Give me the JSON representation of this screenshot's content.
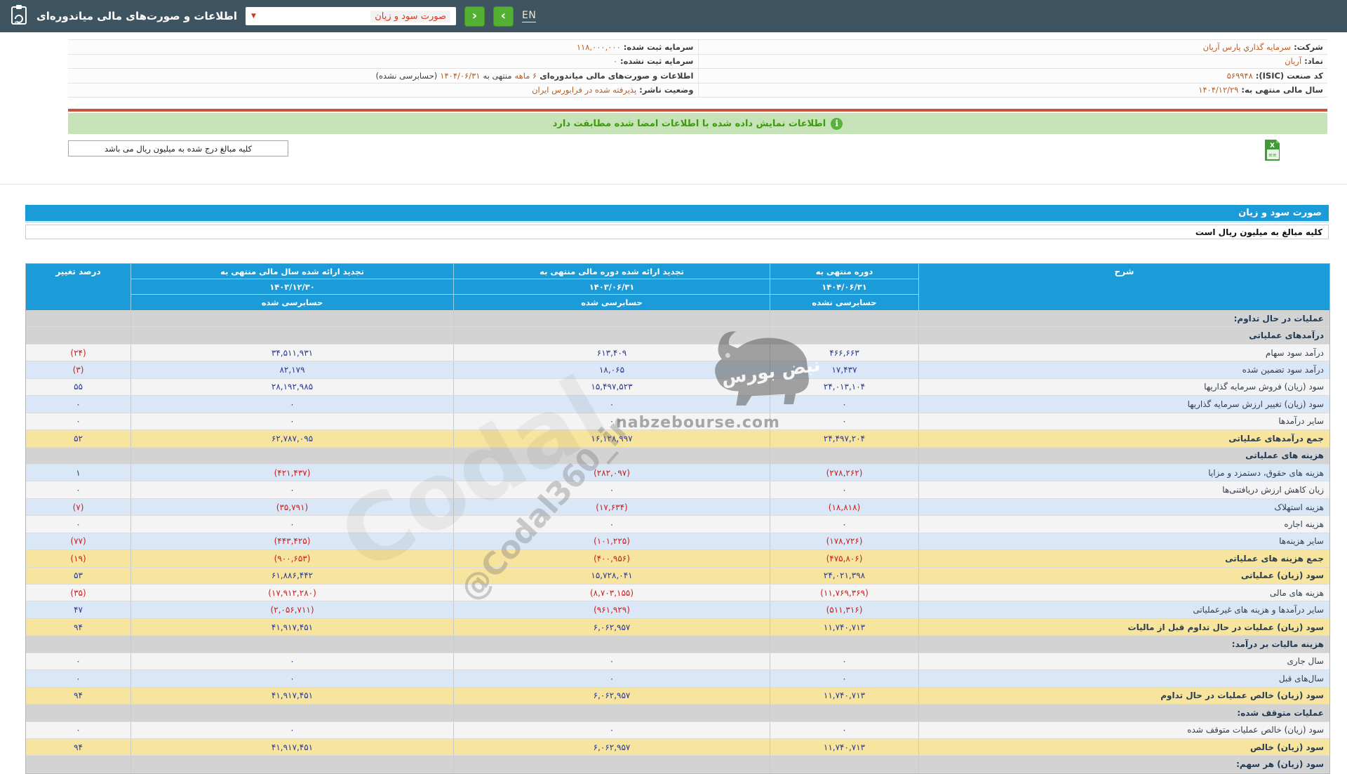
{
  "topbar": {
    "en_label": "EN",
    "title": "اطلاعات و صورت‌های مالی میاندوره‌ای",
    "dropdown_value": "صورت سود و زیان",
    "dropdown_caret": "▼",
    "next_label": "›",
    "prev_label": "‹"
  },
  "company": {
    "rows": [
      {
        "r_label": "شرکت:",
        "r_value": "سرمایه گذاري پارس آریان",
        "l_label": "سرمایه ثبت شده:",
        "l_v1": "۱۱۸,۰۰۰,۰۰۰"
      },
      {
        "r_label": "نماد:",
        "r_value": "آریان",
        "l_label": "سرمایه ثبت نشده:",
        "l_v1": "۰"
      },
      {
        "r_label": "کد صنعت (ISIC):",
        "r_value": "۵۶۹۹۴۸",
        "l_label": "اطلاعات و صورت‌های مالی میاندوره‌ای",
        "l_v1": "۶ ماهه",
        "l_mid": "منتهی به",
        "l_v2": "۱۴۰۴/۰۶/۳۱",
        "l_suffix": "(حسابرسی نشده)"
      },
      {
        "r_label": "سال مالی منتهی به:",
        "r_value": "۱۴۰۴/۱۲/۲۹",
        "l_label": "وضعیت ناشر:",
        "l_v1": "پذیرفته شده در فرابورس ایران"
      }
    ]
  },
  "notice": {
    "text": "اطلاعات نمایش داده شده با اطلاعات امضا شده مطابقت دارد",
    "icon_glyph": "i"
  },
  "amounts_note": "کلیه مبالغ درج شده به میلیون ریال می باشد",
  "statement": {
    "title": "صورت سود و زیان",
    "unit_note": "کلیه مبالغ به میلیون ریال است"
  },
  "table": {
    "desc_header": "شرح",
    "pct_header": "درصد تغییر",
    "col_groups": [
      {
        "top": "دوره منتهی به",
        "date": "۱۴۰۴/۰۶/۳۱",
        "audit": "حسابرسی نشده"
      },
      {
        "top": "تجدید ارائه شده دوره مالی منتهی به",
        "date": "۱۴۰۳/۰۶/۳۱",
        "audit": "حسابرسی شده"
      },
      {
        "top": "تجدید ارائه شده سال مالی منتهی به",
        "date": "۱۴۰۳/۱۲/۳۰",
        "audit": "حسابرسی شده"
      }
    ],
    "rows": [
      {
        "variant": "section",
        "label": "عملیات در حال تداوم:"
      },
      {
        "variant": "section",
        "label": "درآمدهای عملیاتی"
      },
      {
        "variant": "white",
        "label": "درآمد سود سهام",
        "c1": "۴۶۶,۶۶۳",
        "c2": "۶۱۳,۴۰۹",
        "c3": "۳۴,۵۱۱,۹۳۱",
        "pct": "(۲۴)"
      },
      {
        "variant": "blue",
        "label": "درآمد سود تضمین شده",
        "c1": "۱۷,۴۳۷",
        "c2": "۱۸,۰۶۵",
        "c3": "۸۲,۱۷۹",
        "pct": "(۳)"
      },
      {
        "variant": "white",
        "label": "سود (زیان) فروش سرمایه گذاریها",
        "c1": "۲۴,۰۱۳,۱۰۴",
        "c2": "۱۵,۴۹۷,۵۲۳",
        "c3": "۲۸,۱۹۲,۹۸۵",
        "pct": "۵۵"
      },
      {
        "variant": "blue",
        "label": "سود (زیان) تغییر ارزش سرمایه گذاریها",
        "c1": "۰",
        "c2": "۰",
        "c3": "۰",
        "pct": "۰"
      },
      {
        "variant": "white",
        "label": "سایر درآمدها",
        "c1": "۰",
        "c2": "۰",
        "c3": "۰",
        "pct": "۰"
      },
      {
        "variant": "yellow",
        "label": "جمع درآمدهای عملیاتی",
        "c1": "۲۴,۴۹۷,۲۰۴",
        "c2": "۱۶,۱۲۸,۹۹۷",
        "c3": "۶۲,۷۸۷,۰۹۵",
        "pct": "۵۲"
      },
      {
        "variant": "section",
        "label": "هزینه های عملیاتی"
      },
      {
        "variant": "blue",
        "label": "هزینه های حقوق، دستمزد و مزایا",
        "c1": "(۲۷۸,۲۶۲)",
        "c2": "(۲۸۲,۰۹۷)",
        "c3": "(۴۲۱,۴۳۷)",
        "pct": "۱"
      },
      {
        "variant": "white",
        "label": "زیان کاهش ارزش دریافتنی‌ها",
        "c1": "۰",
        "c2": "۰",
        "c3": "۰",
        "pct": "۰"
      },
      {
        "variant": "blue",
        "label": "هزینه استهلاک",
        "c1": "(۱۸,۸۱۸)",
        "c2": "(۱۷,۶۳۴)",
        "c3": "(۳۵,۷۹۱)",
        "pct": "(۷)"
      },
      {
        "variant": "white",
        "label": "هزینه اجاره",
        "c1": "۰",
        "c2": "۰",
        "c3": "۰",
        "pct": "۰"
      },
      {
        "variant": "blue",
        "label": "سایر هزینه‌ها",
        "c1": "(۱۷۸,۷۲۶)",
        "c2": "(۱۰۱,۲۲۵)",
        "c3": "(۴۴۳,۴۲۵)",
        "pct": "(۷۷)"
      },
      {
        "variant": "yellow",
        "label": "جمع هزینه های عملیاتی",
        "c1": "(۴۷۵,۸۰۶)",
        "c2": "(۴۰۰,۹۵۶)",
        "c3": "(۹۰۰,۶۵۳)",
        "pct": "(۱۹)"
      },
      {
        "variant": "yellow",
        "label": "سود (زیان) عملیاتی",
        "c1": "۲۴,۰۲۱,۳۹۸",
        "c2": "۱۵,۷۲۸,۰۴۱",
        "c3": "۶۱,۸۸۶,۴۴۲",
        "pct": "۵۳"
      },
      {
        "variant": "white",
        "label": "هزینه های مالی",
        "c1": "(۱۱,۷۶۹,۳۶۹)",
        "c2": "(۸,۷۰۳,۱۵۵)",
        "c3": "(۱۷,۹۱۲,۲۸۰)",
        "pct": "(۳۵)"
      },
      {
        "variant": "blue",
        "label": "سایر درآمدها و هزینه های غیرعملیاتی",
        "c1": "(۵۱۱,۳۱۶)",
        "c2": "(۹۶۱,۹۲۹)",
        "c3": "(۲,۰۵۶,۷۱۱)",
        "pct": "۴۷"
      },
      {
        "variant": "yellow",
        "label": "سود (زیان) عملیات در حال تداوم قبل از مالیات",
        "c1": "۱۱,۷۴۰,۷۱۳",
        "c2": "۶,۰۶۲,۹۵۷",
        "c3": "۴۱,۹۱۷,۴۵۱",
        "pct": "۹۴"
      },
      {
        "variant": "section",
        "label": "هزینه مالیات بر درآمد:"
      },
      {
        "variant": "white",
        "label": "سال جاری",
        "c1": "۰",
        "c2": "۰",
        "c3": "۰",
        "pct": "۰"
      },
      {
        "variant": "blue",
        "label": "سال‌های قبل",
        "c1": "۰",
        "c2": "۰",
        "c3": "۰",
        "pct": "۰"
      },
      {
        "variant": "yellow",
        "label": "سود (زیان) خالص عملیات در حال تداوم",
        "c1": "۱۱,۷۴۰,۷۱۳",
        "c2": "۶,۰۶۲,۹۵۷",
        "c3": "۴۱,۹۱۷,۴۵۱",
        "pct": "۹۴"
      },
      {
        "variant": "section",
        "label": "عملیات متوقف شده:"
      },
      {
        "variant": "white",
        "label": "سود (زیان) خالص عملیات متوقف شده",
        "c1": "۰",
        "c2": "۰",
        "c3": "۰",
        "pct": "۰"
      },
      {
        "variant": "yellow",
        "label": "سود (زیان) خالص",
        "c1": "۱۱,۷۴۰,۷۱۳",
        "c2": "۶,۰۶۲,۹۵۷",
        "c3": "۴۱,۹۱۷,۴۵۱",
        "pct": "۹۴"
      },
      {
        "variant": "section",
        "label": "سود (زیان) هر سهم:"
      }
    ]
  },
  "watermark": {
    "brand_fa": "نبض بورس",
    "site": "nabzebourse.com",
    "handle": "@Codal360_ir",
    "ghost": "Codal"
  },
  "colors": {
    "topbar": "#3e5561",
    "header_blue": "#1b9cd8",
    "green_notice_bg": "#c6e3b7",
    "row_yellow": "#f7e49e",
    "row_blue": "#d9e7f6",
    "section_gray": "#d3d3d3",
    "value_blue": "#2b3990",
    "value_red": "#c9211e",
    "orange_value": "#bf5a1a",
    "red_separator": "#cb5440",
    "green_button": "#53b032"
  }
}
